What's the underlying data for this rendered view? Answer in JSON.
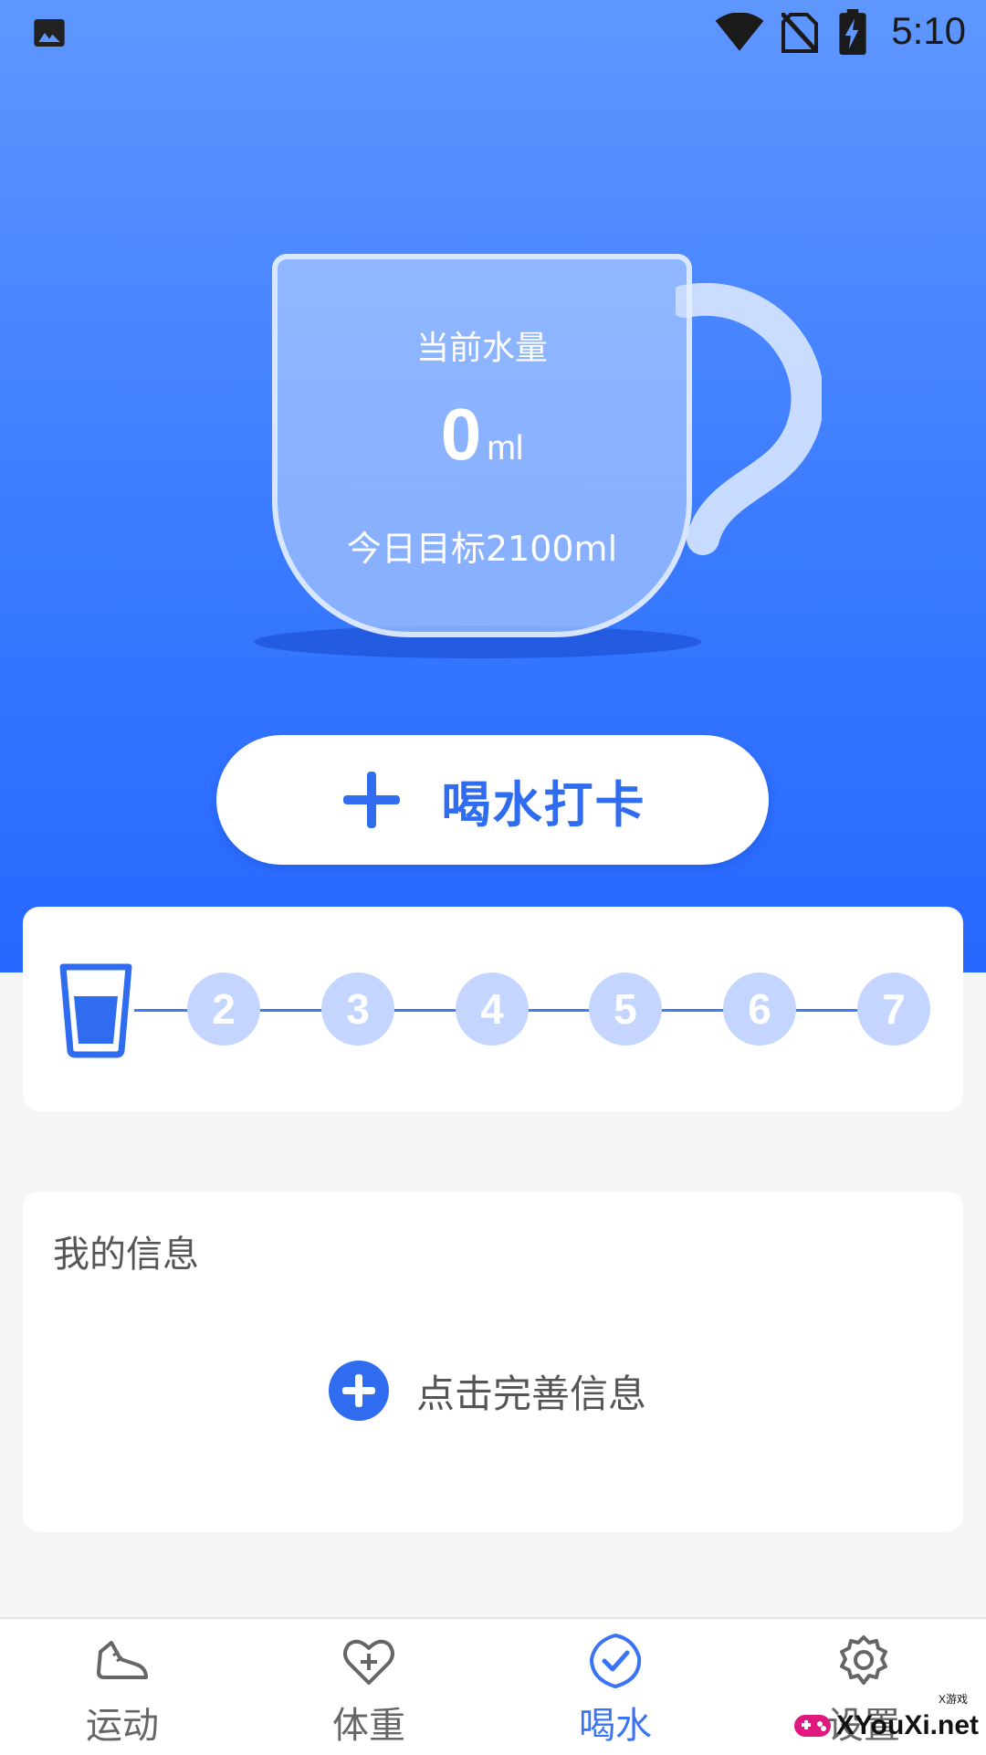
{
  "status_bar": {
    "time": "5:10"
  },
  "cup": {
    "label": "当前水量",
    "value": "0",
    "unit": "ml",
    "goal_text": "今日目标2100ml"
  },
  "checkin_button": {
    "label": "喝水打卡"
  },
  "progress": {
    "days": [
      "2",
      "3",
      "4",
      "5",
      "6",
      "7"
    ]
  },
  "info_card": {
    "title": "我的信息",
    "action_label": "点击完善信息"
  },
  "bottom_nav": {
    "items": [
      {
        "label": "运动",
        "icon": "sneaker-icon",
        "active": false
      },
      {
        "label": "体重",
        "icon": "heart-plus-icon",
        "active": false
      },
      {
        "label": "喝水",
        "icon": "check-circle-icon",
        "active": true
      },
      {
        "label": "设置",
        "icon": "gear-icon",
        "active": false
      }
    ]
  },
  "watermark": {
    "text": "XYouXi.net",
    "tag": "X游戏"
  },
  "colors": {
    "accent": "#2f6cf0",
    "hero_top": "#5f97ff",
    "hero_bottom": "#2667ff",
    "day_circle": "#c4d6ff"
  }
}
